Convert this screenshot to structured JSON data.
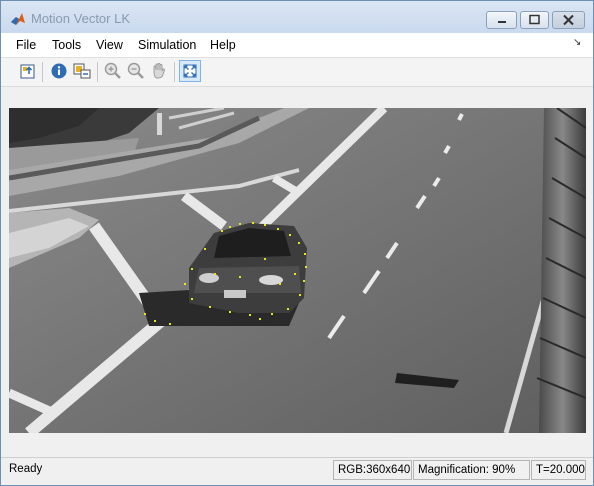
{
  "window": {
    "title": "Motion Vector LK"
  },
  "menubar": {
    "items": [
      {
        "label": "File"
      },
      {
        "label": "Tools"
      },
      {
        "label": "View"
      },
      {
        "label": "Simulation"
      },
      {
        "label": "Help"
      }
    ]
  },
  "toolbar": {
    "buttons": [
      {
        "icon": "parent-model-icon"
      },
      {
        "icon": "info-icon"
      },
      {
        "icon": "highlight-signal-icon"
      },
      {
        "icon": "zoom-in-icon"
      },
      {
        "icon": "zoom-out-icon"
      },
      {
        "icon": "pan-hand-icon"
      },
      {
        "icon": "fit-to-view-icon"
      }
    ]
  },
  "status": {
    "state": "Ready",
    "rgb": "RGB:360x640",
    "magnification": "Magnification: 90%",
    "time": "T=20.000"
  },
  "colors": {
    "motion_vectors": "#e6e61a",
    "selected_tool": "#d8eaf9"
  }
}
